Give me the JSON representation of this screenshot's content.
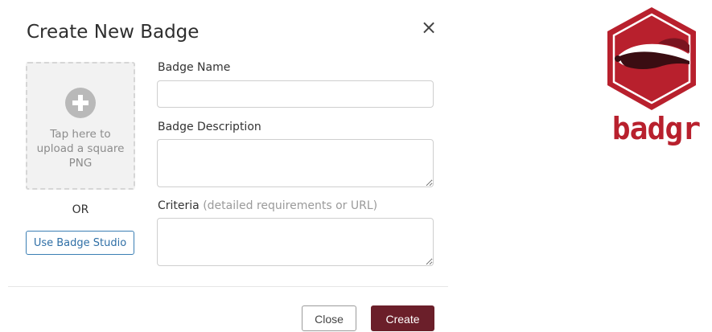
{
  "dialog": {
    "title": "Create New Badge",
    "close_glyph": "×",
    "close_icon": "close-icon"
  },
  "upload": {
    "icon": "plus-circle-icon",
    "text": "Tap here to upload a square PNG",
    "or_label": "OR",
    "studio_button": "Use Badge Studio"
  },
  "fields": {
    "name_label": "Badge Name",
    "name_value": "",
    "description_label": "Badge Description",
    "description_value": "",
    "criteria_label": "Criteria",
    "criteria_hint": "(detailed requirements or URL)",
    "criteria_value": ""
  },
  "footer": {
    "close_label": "Close",
    "create_label": "Create"
  },
  "brand": {
    "wordmark": "badgr",
    "logo_icon": "badger-hexagon-icon",
    "colors": {
      "primary": "#b8202d",
      "button": "#6b1f2a",
      "link": "#2f6fa6"
    }
  }
}
